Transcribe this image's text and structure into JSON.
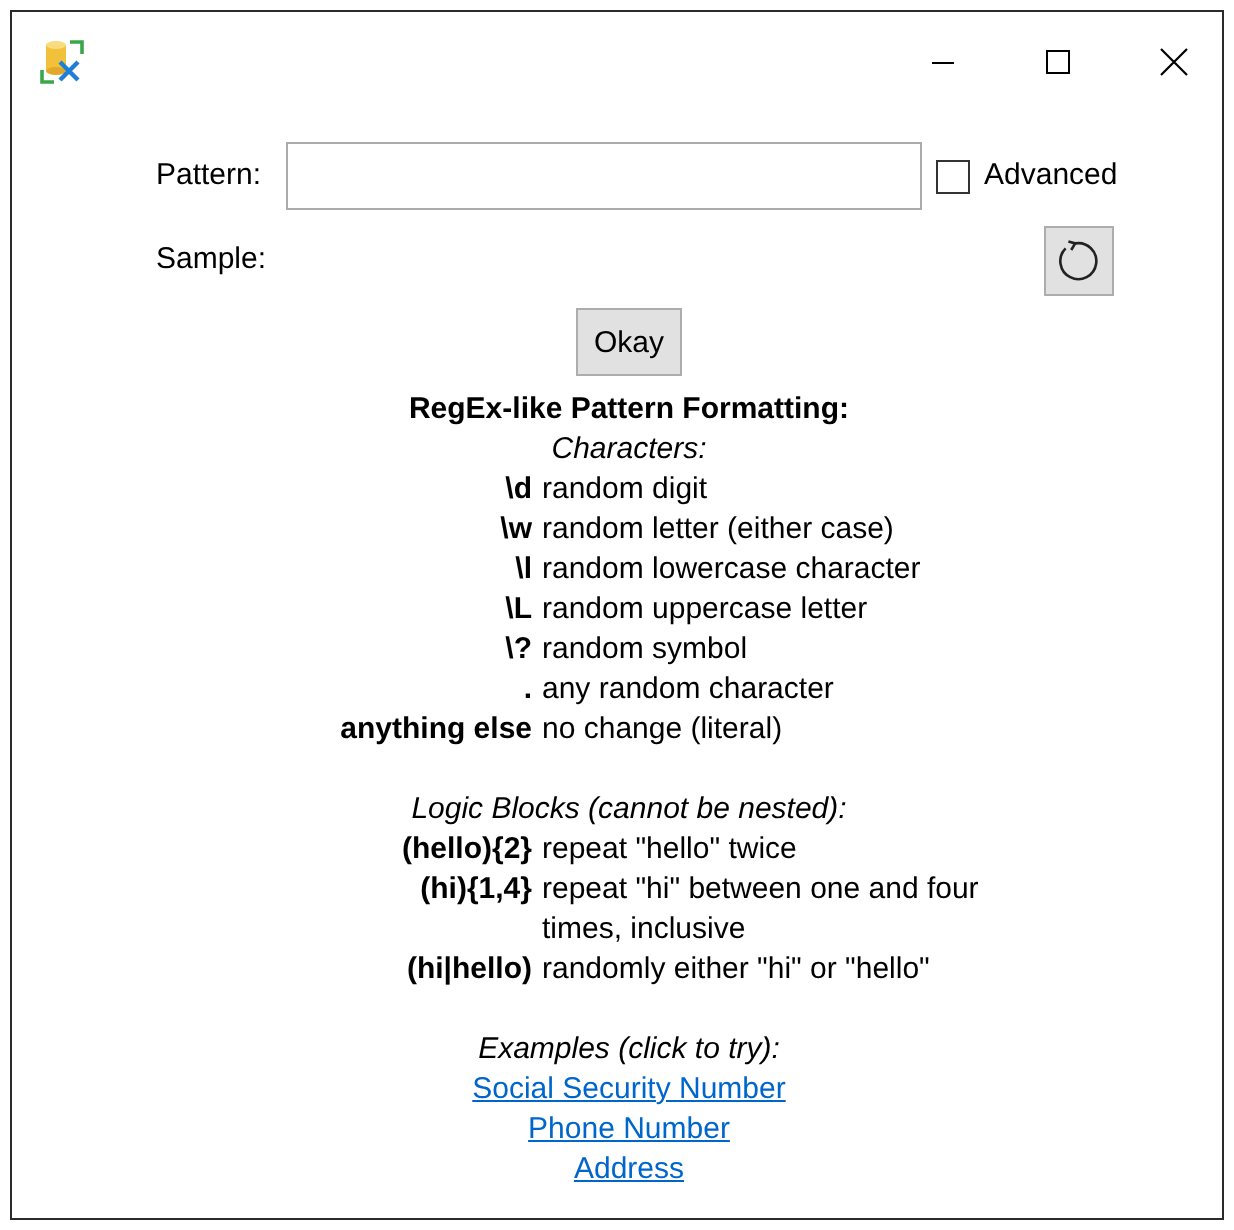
{
  "form": {
    "pattern": {
      "label": "Pattern:"
    },
    "advanced": {
      "label": "Advanced",
      "checked": false
    },
    "sample": {
      "label": "Sample:"
    },
    "okay_button": "Okay"
  },
  "help": {
    "title": "RegEx-like Pattern Formatting:",
    "sections": [
      {
        "heading": "Characters:",
        "rows": [
          {
            "token": "\\d",
            "description": "random digit"
          },
          {
            "token": "\\w",
            "description": "random letter (either case)"
          },
          {
            "token": "\\l",
            "description": "random lowercase character"
          },
          {
            "token": "\\L",
            "description": "random uppercase letter"
          },
          {
            "token": "\\?",
            "description": "random symbol"
          },
          {
            "token": ".",
            "description": "any random character"
          },
          {
            "token": "anything else",
            "description": "no change (literal)"
          }
        ]
      },
      {
        "heading": "Logic Blocks (cannot be nested):",
        "rows": [
          {
            "token": "(hello){2}",
            "description": "repeat \"hello\" twice"
          },
          {
            "token": "(hi){1,4}",
            "description": "repeat \"hi\" between one and four times, inclusive"
          },
          {
            "token": "(hi|hello)",
            "description": "randomly either \"hi\" or \"hello\""
          }
        ]
      }
    ],
    "examples": {
      "heading": "Examples (click to try):",
      "links": [
        "Social Security Number",
        "Phone Number",
        "Address"
      ]
    }
  }
}
